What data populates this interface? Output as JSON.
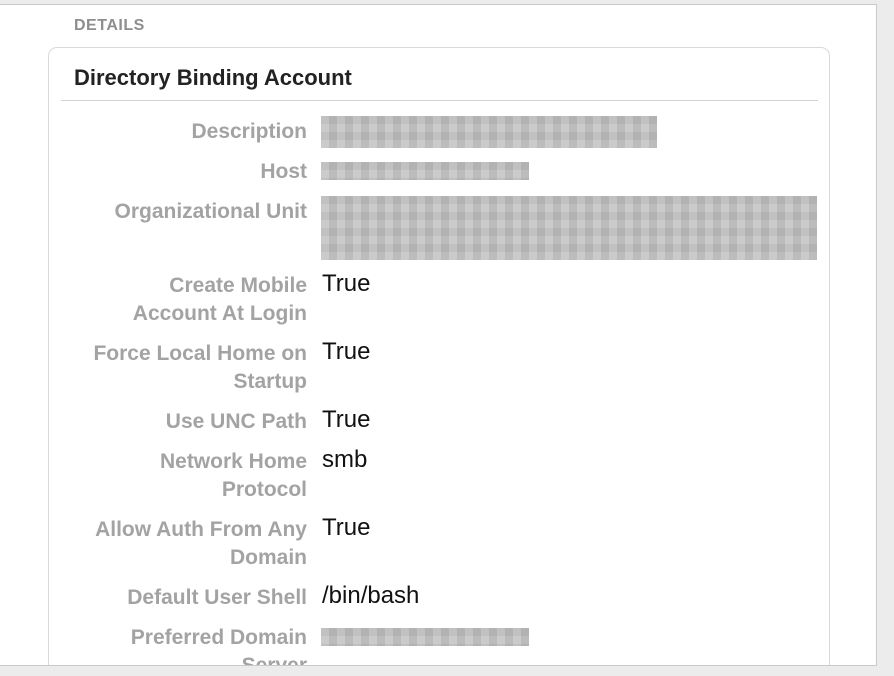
{
  "section": {
    "header": "DETAILS"
  },
  "card": {
    "title": "Directory Binding Account",
    "rows": [
      {
        "label": "Description",
        "value": null
      },
      {
        "label": "Host",
        "value": null
      },
      {
        "label": "Organizational Unit",
        "value": null
      },
      {
        "label_line1": "Create Mobile",
        "label_line2": "Account At Login",
        "value": "True"
      },
      {
        "label_line1": "Force Local Home on",
        "label_line2": "Startup",
        "value": "True"
      },
      {
        "label": "Use UNC Path",
        "value": "True"
      },
      {
        "label_line1": "Network Home",
        "label_line2": "Protocol",
        "value": "smb"
      },
      {
        "label_line1": "Allow Auth From Any",
        "label_line2": "Domain",
        "value": "True"
      },
      {
        "label": "Default User Shell",
        "value": "/bin/bash"
      },
      {
        "label_line1": "Preferred Domain",
        "label_line2": "Server",
        "value": null
      }
    ]
  }
}
